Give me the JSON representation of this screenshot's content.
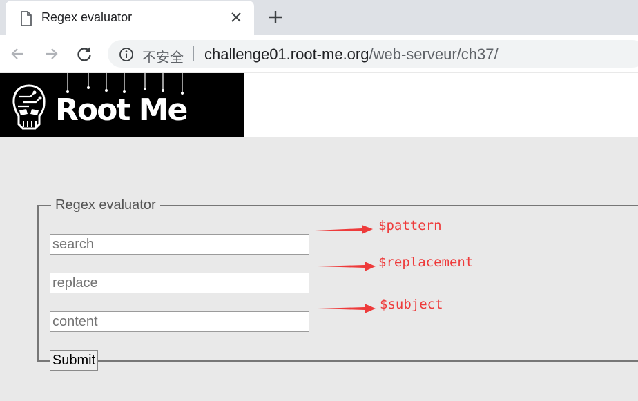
{
  "browser": {
    "tab_title": "Regex evaluator",
    "security_label": "不安全",
    "url_host": "challenge01.root-me.org",
    "url_path": "/web-serveur/ch37/"
  },
  "site": {
    "logo_text": "Root Me"
  },
  "form": {
    "legend": "Regex evaluator",
    "search_placeholder": "search",
    "replace_placeholder": "replace",
    "content_placeholder": "content",
    "submit_label": "Submit"
  },
  "annotations": {
    "color": "#ee3b3b",
    "pattern": "$pattern",
    "replacement": "$replacement",
    "subject": "$subject"
  }
}
